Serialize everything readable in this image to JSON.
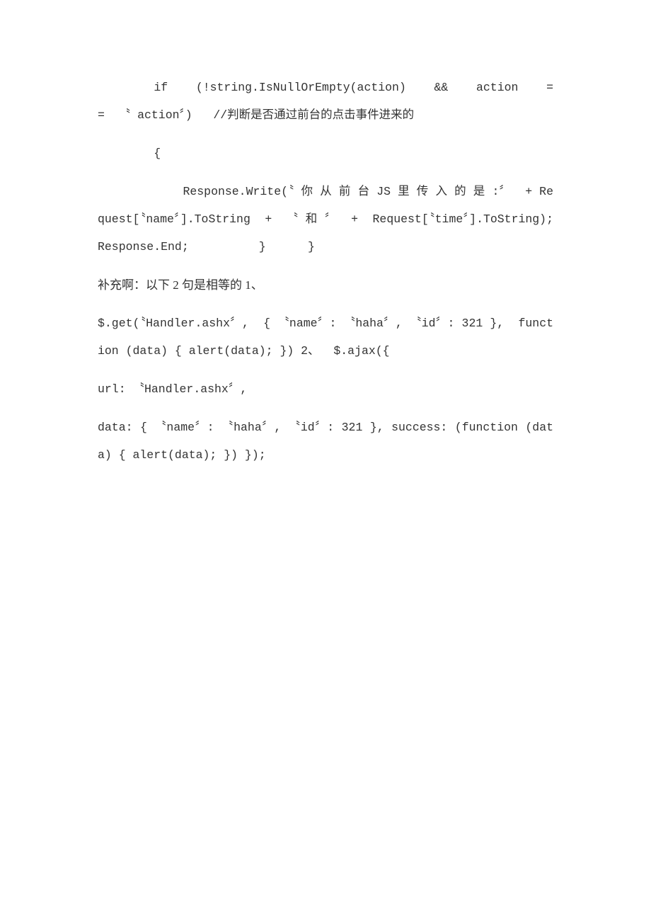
{
  "document": {
    "background_color": "#ffffff",
    "text_color": "#333333",
    "blocks": [
      {
        "id": "code-if-condition",
        "kind": "code",
        "text": "        if    (!string.IsNullOrEmpty(action)    &&    action    ==  〝 action〞)   //判断是否通过前台的点击事件进来的"
      },
      {
        "id": "code-open-brace",
        "kind": "code",
        "text": "        {"
      },
      {
        "id": "code-response-write",
        "kind": "code",
        "text": "            Response.Write(〝 你 从 前 台 JS 里 传 入 的 是 :〞  + Request[〝name〞].ToString  +  〝 和 〞  +  Request[〝time〞].ToString); Response.End;          }      }"
      },
      {
        "id": "note-supplement",
        "kind": "chinese-note",
        "text": "补充啊：以下 2 句是相等的 1、"
      },
      {
        "id": "code-jquery-get",
        "kind": "code",
        "text": "$.get(〝Handler.ashx〞,  { 〝name〞: 〝haha〞, 〝id〞: 321 },  function (data) { alert(data); }) 2、  $.ajax({"
      },
      {
        "id": "code-ajax-url",
        "kind": "code",
        "text": "url: 〝Handler.ashx〞,"
      },
      {
        "id": "code-ajax-data",
        "kind": "code",
        "text": "data: { 〝name〞: 〝haha〞, 〝id〞: 321 }, success: (function (data) { alert(data); }) });"
      }
    ]
  }
}
